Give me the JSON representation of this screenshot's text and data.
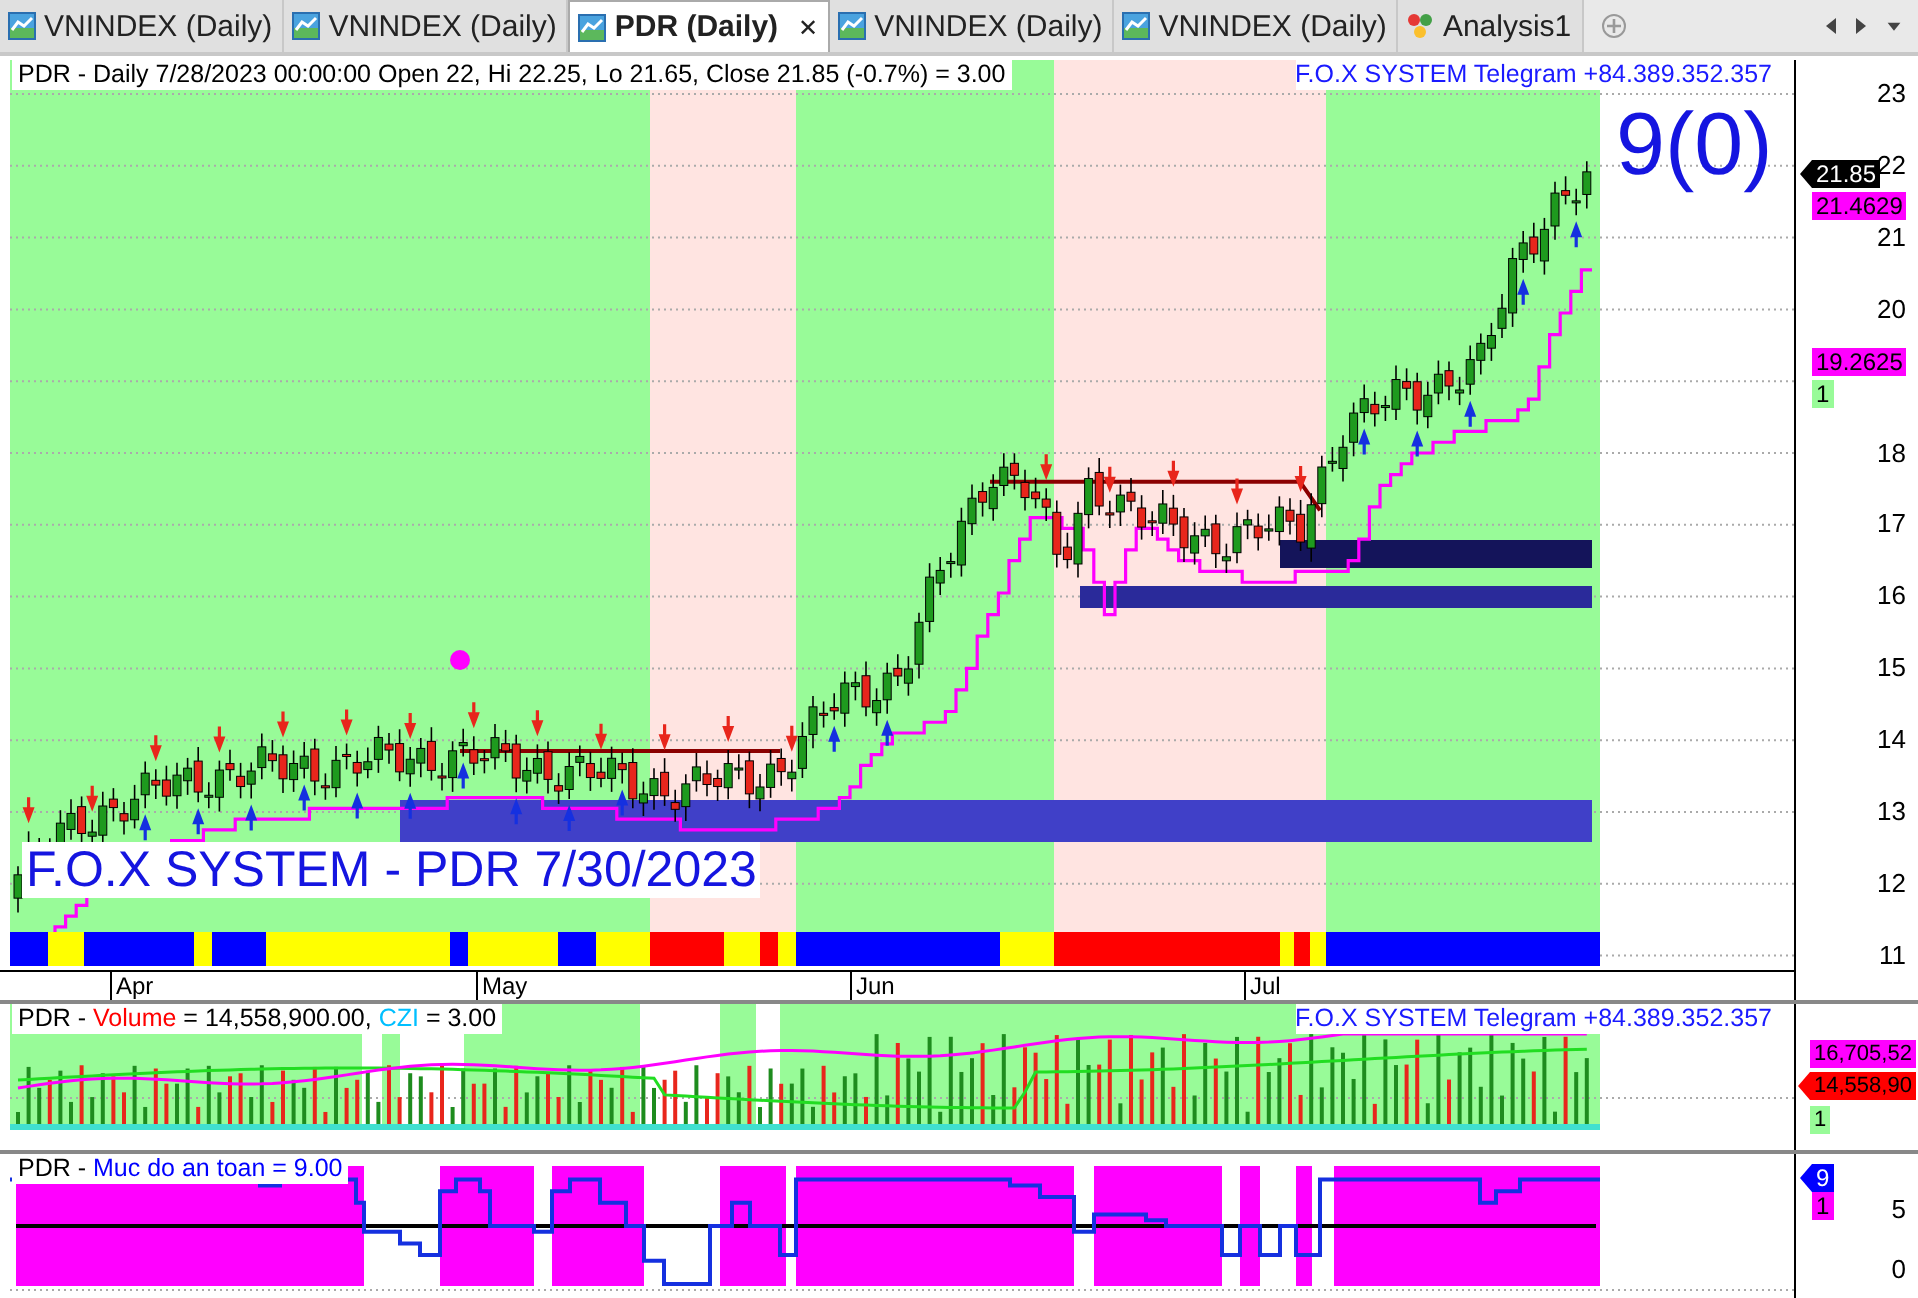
{
  "tabs": [
    {
      "label": "VNINDEX (Daily)",
      "kind": "chart",
      "selected": false
    },
    {
      "label": "VNINDEX (Daily)",
      "kind": "chart",
      "selected": false
    },
    {
      "label": "PDR (Daily)",
      "kind": "chart",
      "selected": true,
      "close": "✕"
    },
    {
      "label": "VNINDEX (Daily)",
      "kind": "chart",
      "selected": false
    },
    {
      "label": "VNINDEX (Daily)",
      "kind": "chart",
      "selected": false
    },
    {
      "label": "Analysis1",
      "kind": "analysis",
      "selected": false
    }
  ],
  "price_panel": {
    "header": "PDR - Daily 7/28/2023 00:00:00 Open 22, Hi 22.25, Lo 21.65, Close 21.85 (-0.7%)  = 3.00",
    "telegram": "F.O.X SYSTEM Telegram +84.389.352.357",
    "signal_count": "9(0)",
    "caption": "F.O.X SYSTEM - PDR 7/30/2023",
    "y_ticks": [
      "23",
      "22",
      "21",
      "20",
      "18",
      "17",
      "16",
      "15",
      "14",
      "13",
      "12",
      "11"
    ],
    "x_labels": [
      "Apr",
      "May",
      "Jun",
      "Jul"
    ],
    "tags": [
      {
        "text": "21.85",
        "color": "#000000",
        "kind": "pointer"
      },
      {
        "text": "21.4629",
        "color": "#ff00ff",
        "kind": "box"
      },
      {
        "text": "19.2625",
        "color": "#ff00ff",
        "kind": "box"
      },
      {
        "text": "1",
        "color": "#98fb98",
        "kind": "box"
      }
    ]
  },
  "volume_panel": {
    "header": [
      {
        "text": "PDR - ",
        "color": "#000000"
      },
      {
        "text": "Volume",
        "color": "#ff0000"
      },
      {
        "text": " = 14,558,900.00, ",
        "color": "#000000"
      },
      {
        "text": "CZI",
        "color": "#00bfff"
      },
      {
        "text": " = 3.00",
        "color": "#000000"
      }
    ],
    "telegram": "F.O.X SYSTEM Telegram +84.389.352.357",
    "tags": [
      {
        "text": "16,705,52",
        "color": "#ff00ff",
        "kind": "box"
      },
      {
        "text": "14,558,90",
        "color": "#ff0000",
        "kind": "pointer"
      },
      {
        "text": "1",
        "color": "#98fb98",
        "kind": "box"
      }
    ]
  },
  "safety_panel": {
    "header": [
      {
        "text": "PDR - ",
        "color": "#000000"
      },
      {
        "text": "Muc do an toan = 9.00",
        "color": "#0000ff"
      }
    ],
    "y_ticks": [
      "5",
      "0"
    ],
    "tags": [
      {
        "text": "9",
        "color": "#0000ff",
        "kind": "pointer"
      },
      {
        "text": "1",
        "color": "#ff00ff",
        "kind": "box"
      }
    ]
  }
}
